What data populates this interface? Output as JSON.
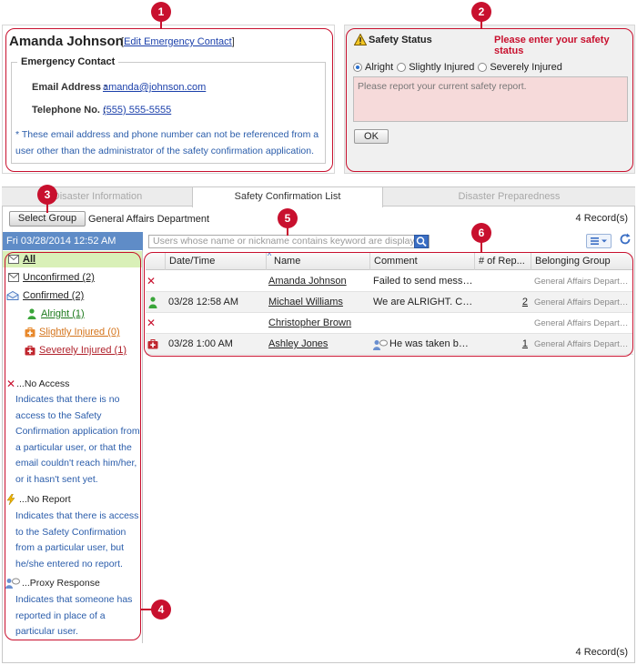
{
  "callouts": [
    "1",
    "2",
    "3",
    "4",
    "5",
    "6"
  ],
  "user": {
    "name": "Amanda Johnson",
    "edit_link": "Edit Emergency Contact",
    "edit_open": "[",
    "edit_close": "]"
  },
  "emergency": {
    "legend": "Emergency Contact",
    "email_label": "Email Address :",
    "email": "amanda@johnson.com",
    "phone_label": "Telephone No. :",
    "phone": "(555) 555-5555",
    "note": "* These email address and phone number can not be referenced from a user other than the administrator of the safety confirmation application."
  },
  "safety": {
    "title": "Safety Status",
    "warning": "Please enter your safety status",
    "options": [
      "Alright",
      "Slightly Injured",
      "Severely Injured"
    ],
    "selected": "Alright",
    "placeholder": "Please report your current safety report.",
    "ok": "OK"
  },
  "tabs": [
    "Disaster Information",
    "Safety Confirmation List",
    "Disaster Preparedness"
  ],
  "active_tab": "Safety Confirmation List",
  "toolbar": {
    "select_group": "Select Group",
    "group_name": "General Affairs Department",
    "records_top": "4 Record(s)",
    "records_bottom": "4 Record(s)",
    "search_placeholder": "Users whose name or nickname contains keyword are display..."
  },
  "sidebar": {
    "date": "Fri 03/28/2014 12:52 AM",
    "all": "All",
    "unconfirmed": "Unconfirmed (2)",
    "confirmed": "Confirmed (2)",
    "alright": "Alright (1)",
    "slightly": "Slightly Injured (0)",
    "severely": "Severely Injured (1)",
    "colors": {
      "alright": "#1d7a1d",
      "slightly": "#d4731a",
      "severely": "#b0202a"
    }
  },
  "legend": [
    {
      "icon": "x-icon",
      "title": "...No Access",
      "text": "Indicates that there is no access to the Safety Confirmation application from a particular user, or that the email couldn't reach him/her, or it hasn't sent yet."
    },
    {
      "icon": "lightning-icon",
      "title": "...No Report",
      "text": "Indicates that there is access to the Safety Confirmation from a particular user, but he/she entered no report."
    },
    {
      "icon": "proxy-icon",
      "title": "...Proxy Response",
      "text": "Indicates that someone has reported in place of a particular user."
    }
  ],
  "grid": {
    "headers": [
      "Date/Time",
      "Name",
      "Comment",
      "# of Rep...",
      "Belonging Group"
    ],
    "rows": [
      {
        "status": "x-icon",
        "date": "",
        "name": "Amanda Johnson",
        "comment": "Failed to send messa...",
        "reports": "",
        "group": "General Affairs Departme..."
      },
      {
        "status": "alright-icon",
        "date": "03/28 12:58 AM",
        "name": "Michael Williams",
        "comment": "We are ALRIGHT. Ch...",
        "reports": "2",
        "group": "General Affairs Departme..."
      },
      {
        "status": "x-icon",
        "date": "",
        "name": "Christopher Brown",
        "comment": "",
        "reports": "",
        "group": "General Affairs Departme..."
      },
      {
        "status": "severe-icon",
        "date": "03/28 1:00 AM",
        "name": "Ashley Jones",
        "comment": "He was taken by ...",
        "reports": "1",
        "group": "General Affairs Departme..."
      }
    ]
  },
  "colors": {
    "accent_red": "#c8102e",
    "link": "#1a3faa",
    "date_bar": "#5f8cc7",
    "selected_row": "#d9f0b8"
  }
}
